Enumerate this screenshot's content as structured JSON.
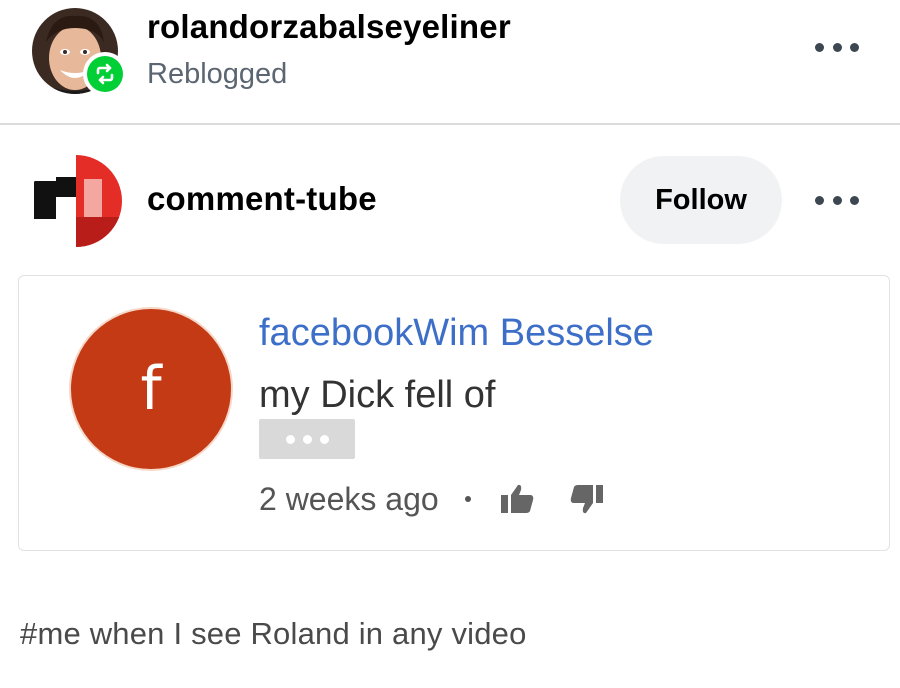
{
  "reblog": {
    "username": "rolandorzabalseyeliner",
    "status_label": "Reblogged",
    "avatar_icon": "user-photo-avatar",
    "badge_icon": "reblog-icon",
    "badge_color": "#00cf35"
  },
  "post": {
    "blog_name": "comment-tube",
    "follow_label": "Follow",
    "avatar_icon": "comment-tube-logo"
  },
  "comment": {
    "avatar_letter": "f",
    "avatar_color": "#c33a15",
    "author": "facebookWim Besselse",
    "text": "my Dick fell of",
    "time": "2 weeks ago",
    "like_icon": "thumbs-up-icon",
    "dislike_icon": "thumbs-down-icon"
  },
  "tags": {
    "line": "#me when I see Roland in any video"
  },
  "colors": {
    "link_blue": "#3d6fc8",
    "muted_gray": "#5b6672",
    "follow_bg": "#f1f2f4"
  }
}
